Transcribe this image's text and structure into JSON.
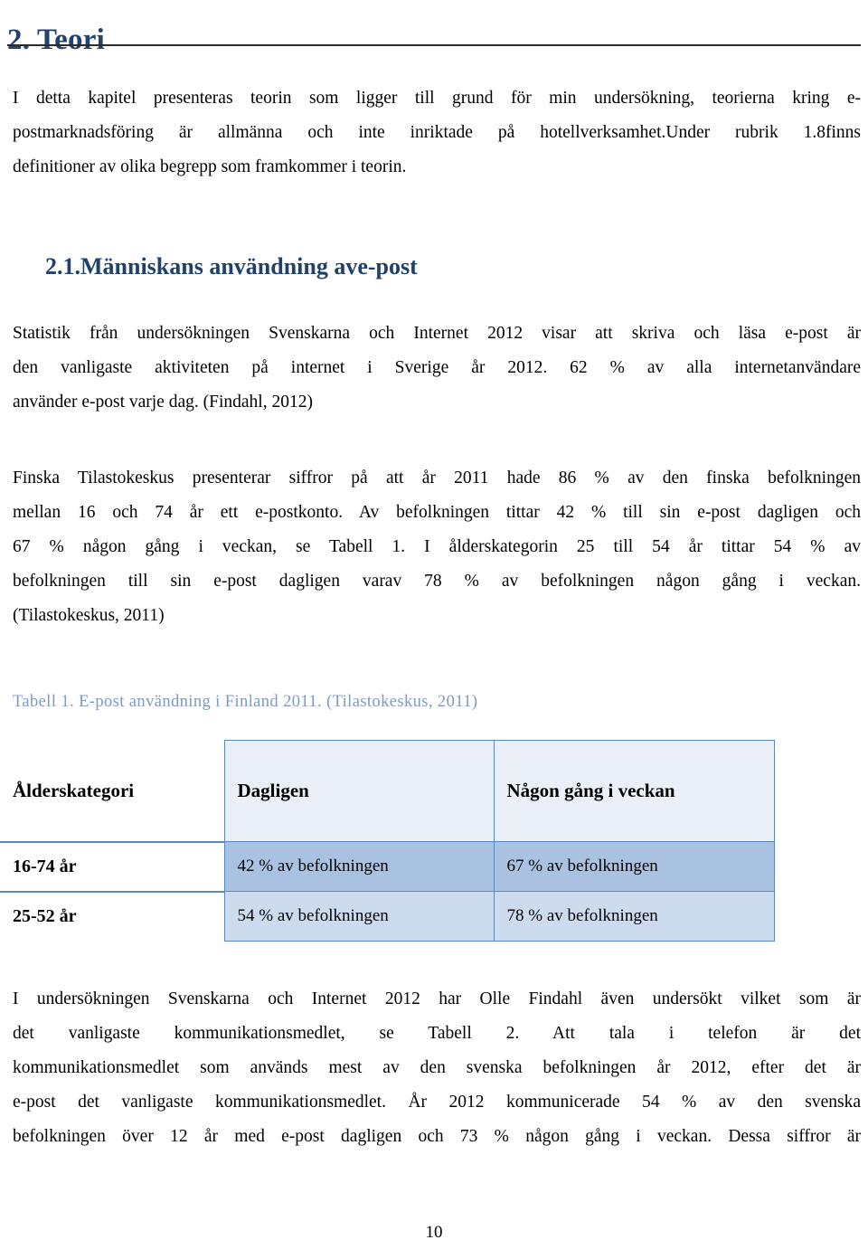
{
  "document": {
    "heading": "2. Teori",
    "sub_heading": "2.1.Människans användning ave-post",
    "page_number": "10",
    "accent_heading_color": "#22436e",
    "caption_color": "#7c9ac4",
    "table_border_color": "#5b88bf"
  },
  "paragraphs": {
    "intro": {
      "line1": "I detta kapitel presenteras teorin som ligger till grund för min undersökning, teorierna kring e-",
      "line2": "postmarknadsföring är allmänna och inte inriktade på hotellverksamhet.Under rubrik 1.8finns",
      "line3": "definitioner av olika begrepp som framkommer i teorin."
    },
    "statistik": {
      "line1": "Statistik från undersökningen Svenskarna och Internet 2012 visar att skriva och läsa e-post är",
      "line2": "den vanligaste aktiviteten på internet i Sverige år 2012. 62 % av alla internetanvändare",
      "line3": "använder e-post varje dag. (Findahl, 2012)"
    },
    "finska": {
      "line1": "Finska Tilastokeskus presenterar siffror på att år 2011 hade 86 % av den finska befolkningen",
      "line2": "mellan 16 och 74 år ett e-postkonto. Av befolkningen tittar 42 % till sin e-post dagligen och",
      "line3": "67 % någon gång i veckan, se Tabell 1. I ålderskategorin 25 till 54 år tittar 54 % av",
      "line4": "befolkningen till sin e-post dagligen varav 78 % av befolkningen någon gång i veckan.",
      "line5": "(Tilastokeskus, 2011)"
    },
    "final": {
      "line1": "I undersökningen Svenskarna och Internet 2012 har Olle Findahl även undersökt vilket som är",
      "line2": "det vanligaste kommunikationsmedlet, se Tabell 2. Att tala i telefon är det",
      "line3": "kommunikationsmedlet som används mest av den svenska befolkningen år 2012, efter det är",
      "line4": "e-post det vanligaste kommunikationsmedlet. År 2012 kommunicerade 54 % av den svenska",
      "line5": "befolkningen över 12 år med e-post dagligen och 73 % någon gång i veckan. Dessa siffror är"
    }
  },
  "table": {
    "caption": "Tabell 1. E-post användning i Finland 2011. (Tilastokeskus, 2011)",
    "headers": [
      "Ålderskategori",
      "Dagligen",
      "Någon gång i veckan"
    ],
    "rows": [
      [
        "16-74 år",
        "42 % av befolkningen",
        "67 % av befolkningen"
      ],
      [
        "25-52 år",
        "54 % av befolkningen",
        "78 % av befolkningen"
      ]
    ]
  },
  "chart_data": {
    "type": "table",
    "title": "Tabell 1. E-post användning i Finland 2011. (Tilastokeskus, 2011)",
    "columns": [
      "Ålderskategori",
      "Dagligen",
      "Någon gång i veckan"
    ],
    "rows": [
      [
        "16-74 år",
        "42 % av befolkningen",
        "67 % av befolkningen"
      ],
      [
        "25-52 år",
        "54 % av befolkningen",
        "78 % av befolkningen"
      ]
    ],
    "values": {
      "dagligen": [
        42,
        54
      ],
      "nagon_gang_i_veckan": [
        67,
        78
      ]
    },
    "categories": [
      "16-74 år",
      "25-52 år"
    ],
    "unit": "% av befolkningen"
  }
}
